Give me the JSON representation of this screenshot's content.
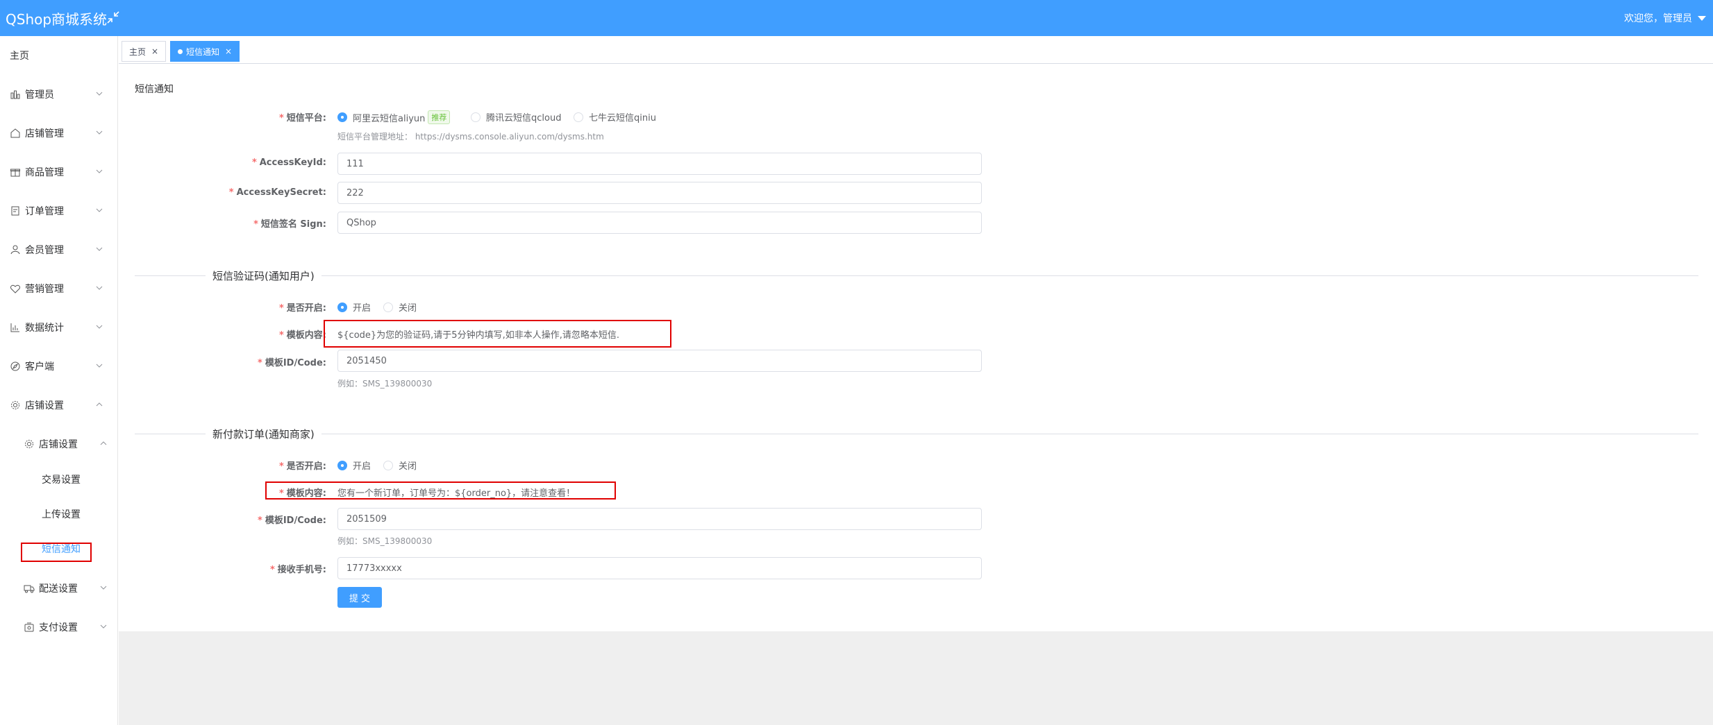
{
  "header": {
    "brand": "QShop商城系统",
    "welcome": "欢迎您，管理员"
  },
  "sidebar": {
    "home": "主页",
    "items": [
      {
        "label": "管理员",
        "icon": "admin-icon"
      },
      {
        "label": "店铺管理",
        "icon": "store-icon"
      },
      {
        "label": "商品管理",
        "icon": "gift-icon"
      },
      {
        "label": "订单管理",
        "icon": "order-icon"
      },
      {
        "label": "会员管理",
        "icon": "user-icon"
      },
      {
        "label": "营销管理",
        "icon": "heart-icon"
      },
      {
        "label": "数据统计",
        "icon": "chart-icon"
      },
      {
        "label": "客户端",
        "icon": "compass-icon"
      },
      {
        "label": "店铺设置",
        "icon": "gear-icon"
      }
    ],
    "sub_group": "店铺设置",
    "sub_items": [
      "交易设置",
      "上传设置",
      "短信通知"
    ],
    "after_items": [
      {
        "label": "配送设置",
        "icon": "truck-icon"
      },
      {
        "label": "支付设置",
        "icon": "wallet-icon"
      }
    ]
  },
  "tabs": [
    {
      "label": "主页",
      "active": false
    },
    {
      "label": "短信通知",
      "active": true
    }
  ],
  "page": {
    "title": "短信通知",
    "platform": {
      "label": "短信平台:",
      "options": [
        "阿里云短信aliyun",
        "腾讯云短信qcloud",
        "七牛云短信qiniu"
      ],
      "recommend_badge": "推荐",
      "selected": 0,
      "hint": "短信平台管理地址： https://dysms.console.aliyun.com/dysms.htm"
    },
    "access_key_id": {
      "label": "AccessKeyId:",
      "value": "111"
    },
    "access_key_secret": {
      "label": "AccessKeySecret:",
      "value": "222"
    },
    "sign": {
      "label": "短信签名 Sign:",
      "value": "QShop"
    },
    "section1": {
      "title": "短信验证码(通知用户)",
      "enabled_label": "是否开启:",
      "on": "开启",
      "off": "关闭",
      "template_label": "模板内容:",
      "template": "${code}为您的验证码,请于5分钟内填写,如非本人操作,请忽略本短信.",
      "code_label": "模板ID/Code:",
      "code_value": "2051450",
      "code_hint": "例如：SMS_139800030"
    },
    "section2": {
      "title": "新付款订单(通知商家)",
      "enabled_label": "是否开启:",
      "on": "开启",
      "off": "关闭",
      "template_label": "模板内容:",
      "template": "您有一个新订单，订单号为：${order_no}，请注意查看！",
      "code_label": "模板ID/Code:",
      "code_value": "2051509",
      "code_hint": "例如：SMS_139800030",
      "phone_label": "接收手机号:",
      "phone_value": "17773xxxxx"
    },
    "submit": "提 交"
  },
  "colors": {
    "primary": "#409eff",
    "highlight": "#e00000",
    "required": "#f56c6c"
  }
}
